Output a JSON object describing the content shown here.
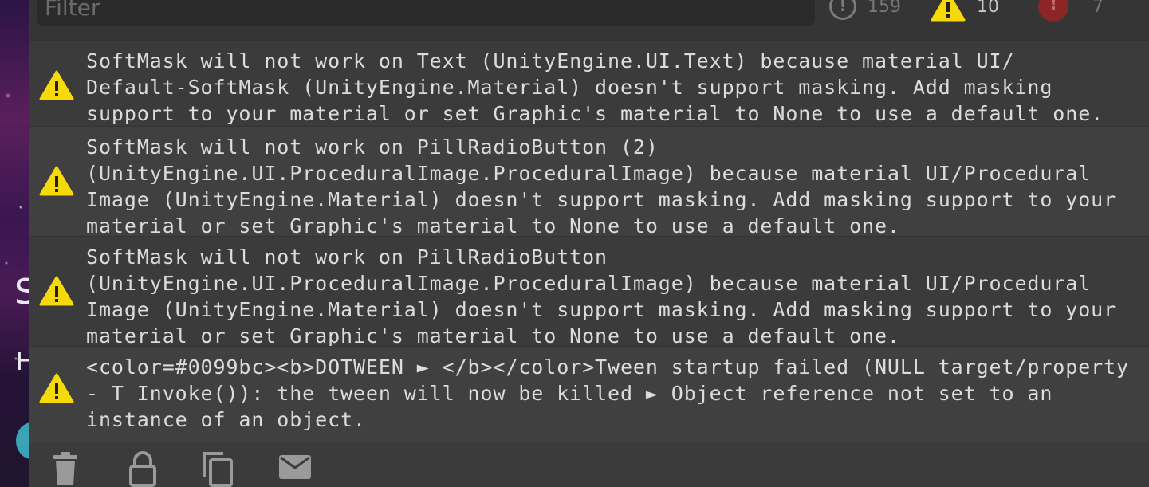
{
  "background": {
    "partial_heading": "S",
    "partial_subheading": "H"
  },
  "toolbar": {
    "filter_placeholder": "Filter",
    "info_count": "159",
    "warning_count": "10",
    "error_count": "7"
  },
  "logs": [
    {
      "level": "warning",
      "icon": "warning-icon",
      "message": "SoftMask will not work on Text (UnityEngine.UI.Text) because material UI/\nDefault-SoftMask (UnityEngine.Material) doesn't support masking. Add masking\nsupport to your material or set Graphic's material to None to use a default one."
    },
    {
      "level": "warning",
      "icon": "warning-icon",
      "message": "SoftMask will not work on PillRadioButton (2)\n(UnityEngine.UI.ProceduralImage.ProceduralImage) because material UI/Procedural\nImage (UnityEngine.Material) doesn't support masking. Add masking support to your\nmaterial or set Graphic's material to None to use a default one."
    },
    {
      "level": "warning",
      "icon": "warning-icon",
      "message": "SoftMask will not work on PillRadioButton\n(UnityEngine.UI.ProceduralImage.ProceduralImage) because material UI/Procedural\nImage (UnityEngine.Material) doesn't support masking. Add masking support to your\nmaterial or set Graphic's material to None to use a default one."
    },
    {
      "level": "warning",
      "icon": "warning-icon",
      "message": "<color=#0099bc><b>DOTWEEN ► </b></color>Tween startup failed (NULL target/property\n- T Invoke()): the tween will now be killed ► Object reference not set to an\ninstance of an object."
    }
  ],
  "bottom_actions": [
    {
      "name": "clear",
      "icon": "trash-icon"
    },
    {
      "name": "lock",
      "icon": "lock-icon"
    },
    {
      "name": "copy",
      "icon": "copy-icon"
    },
    {
      "name": "email",
      "icon": "mail-icon"
    }
  ],
  "colors": {
    "panel_bg": "#3b3b3b",
    "row_alt_bg": "#404040",
    "text": "#dcdcdc",
    "warning_yellow": "#f5d90a",
    "icon_grey": "#9a9a9a",
    "error_red": "#8c2525"
  }
}
